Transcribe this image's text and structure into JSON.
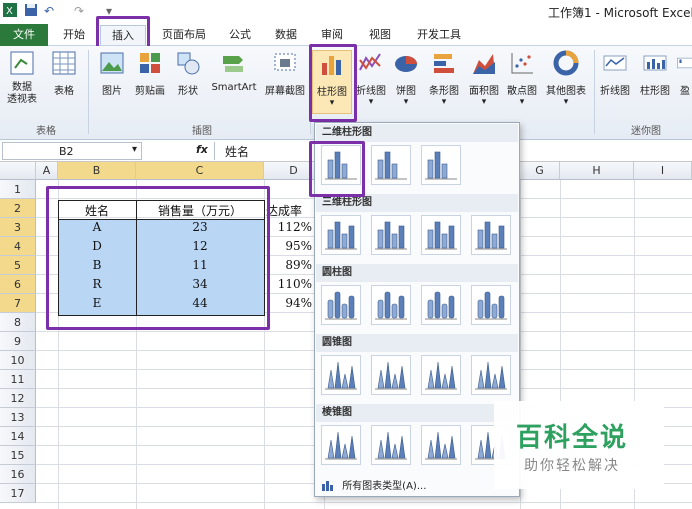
{
  "window": {
    "title": "工作簿1 - Microsoft Excel"
  },
  "tabs": [
    {
      "label": "文件"
    },
    {
      "label": "开始"
    },
    {
      "label": "插入"
    },
    {
      "label": "页面布局"
    },
    {
      "label": "公式"
    },
    {
      "label": "数据"
    },
    {
      "label": "审阅"
    },
    {
      "label": "视图"
    },
    {
      "label": "开发工具"
    }
  ],
  "ribbon": {
    "buttons": [
      {
        "label": "数据\n透视表",
        "icon": "pivot-table-icon"
      },
      {
        "label": "表格",
        "icon": "table-icon"
      },
      {
        "label": "图片",
        "icon": "picture-icon"
      },
      {
        "label": "剪贴画",
        "icon": "clipart-icon"
      },
      {
        "label": "形状",
        "icon": "shapes-icon"
      },
      {
        "label": "SmartArt",
        "icon": "smartart-icon"
      },
      {
        "label": "屏幕截图",
        "icon": "screenshot-icon"
      },
      {
        "label": "柱形图",
        "icon": "column-chart-icon"
      },
      {
        "label": "折线图",
        "icon": "line-chart-icon"
      },
      {
        "label": "饼图",
        "icon": "pie-chart-icon"
      },
      {
        "label": "条形图",
        "icon": "bar-chart-icon"
      },
      {
        "label": "面积图",
        "icon": "area-chart-icon"
      },
      {
        "label": "散点图",
        "icon": "scatter-chart-icon"
      },
      {
        "label": "其他图表",
        "icon": "other-charts-icon"
      },
      {
        "label": "折线图",
        "icon": "sparkline-line-icon"
      },
      {
        "label": "柱形图",
        "icon": "sparkline-column-icon"
      },
      {
        "label": "盈",
        "icon": "sparkline-winloss-icon"
      }
    ],
    "groups": {
      "table": "表格",
      "illustrations": "插图",
      "sparklines": "迷你图"
    }
  },
  "formula_bar": {
    "name_box": "B2",
    "fx": "fx",
    "content": "姓名"
  },
  "columns": [
    "A",
    "B",
    "C",
    "D",
    "G",
    "H",
    "I"
  ],
  "rows": [
    "1",
    "2",
    "3",
    "4",
    "5",
    "6",
    "7",
    "8",
    "9",
    "10",
    "11",
    "12",
    "13",
    "14",
    "15",
    "16",
    "17"
  ],
  "table": {
    "headers": [
      "姓名",
      "销售量（万元）",
      "达成率"
    ],
    "rows": [
      {
        "name": "A",
        "sales": "23",
        "rate": "112%"
      },
      {
        "name": "D",
        "sales": "12",
        "rate": "95%"
      },
      {
        "name": "B",
        "sales": "11",
        "rate": "89%"
      },
      {
        "name": "R",
        "sales": "34",
        "rate": "110%"
      },
      {
        "name": "E",
        "sales": "44",
        "rate": "94%"
      }
    ]
  },
  "dropdown": {
    "sections": [
      "二维柱形图",
      "三维柱形图",
      "圆柱图",
      "圆锥图",
      "棱锥图"
    ],
    "footer": "所有图表类型(A)..."
  },
  "watermark": {
    "title": "百科全说",
    "subtitle": "助你轻松解决"
  },
  "colors": {
    "accent": "#7b2fa8",
    "file_tab": "#2c7a3b",
    "selection": "#b9d6f5"
  }
}
